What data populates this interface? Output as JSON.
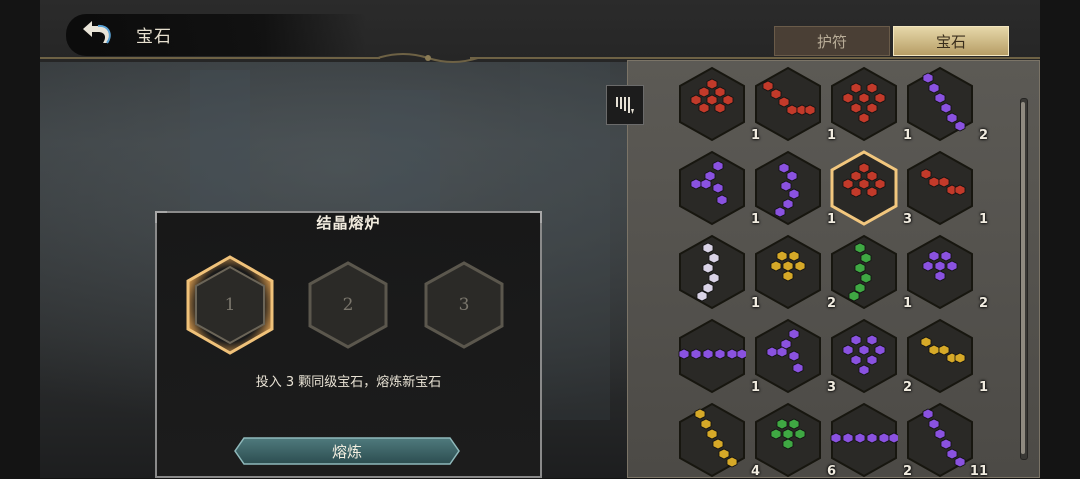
{
  "header": {
    "title": "宝石",
    "back_icon": "back-arrow-icon"
  },
  "tabs": [
    {
      "label": "护符",
      "active": false
    },
    {
      "label": "宝石",
      "active": true
    }
  ],
  "furnace": {
    "title": "结晶熔炉",
    "slots": [
      "1",
      "2",
      "3"
    ],
    "selected_slot": 1,
    "hint": "投入 3 颗同级宝石，熔炼新宝石",
    "smelt_label": "熔炼"
  },
  "inventory": {
    "sort_icon": "sort-icon",
    "gems": [
      {
        "color": "#c23a2a",
        "shape": "triangle",
        "count": "1",
        "selected": false
      },
      {
        "color": "#c23a2a",
        "shape": "chain",
        "count": "1",
        "selected": false
      },
      {
        "color": "#c23a2a",
        "shape": "cluster",
        "count": "1",
        "selected": false
      },
      {
        "color": "#8a52e0",
        "shape": "diagonal",
        "count": "2",
        "selected": false
      },
      {
        "color": "#8a52e0",
        "shape": "branch",
        "count": "1",
        "selected": false
      },
      {
        "color": "#8a52e0",
        "shape": "column",
        "count": "1",
        "selected": false
      },
      {
        "color": "#c23a2a",
        "shape": "triangle",
        "count": "3",
        "selected": true
      },
      {
        "color": "#c23a2a",
        "shape": "steps",
        "count": "1",
        "selected": false
      },
      {
        "color": "#d9d3e6",
        "shape": "wave",
        "count": "1",
        "selected": false
      },
      {
        "color": "#d6a928",
        "shape": "fan",
        "count": "2",
        "selected": false
      },
      {
        "color": "#3fa843",
        "shape": "wave",
        "count": "1",
        "selected": false
      },
      {
        "color": "#8a52e0",
        "shape": "fan",
        "count": "2",
        "selected": false
      },
      {
        "color": "#8a52e0",
        "shape": "row",
        "count": "1",
        "selected": false
      },
      {
        "color": "#8a52e0",
        "shape": "branch",
        "count": "3",
        "selected": false
      },
      {
        "color": "#8a52e0",
        "shape": "cluster",
        "count": "2",
        "selected": false
      },
      {
        "color": "#d6a928",
        "shape": "steps",
        "count": "1",
        "selected": false
      },
      {
        "color": "#d6a928",
        "shape": "diagonal",
        "count": "4",
        "selected": false
      },
      {
        "color": "#3fa843",
        "shape": "fan",
        "count": "6",
        "selected": false
      },
      {
        "color": "#8a52e0",
        "shape": "row",
        "count": "2",
        "selected": false
      },
      {
        "color": "#8a52e0",
        "shape": "diagonal",
        "count": "11",
        "selected": false
      }
    ]
  }
}
